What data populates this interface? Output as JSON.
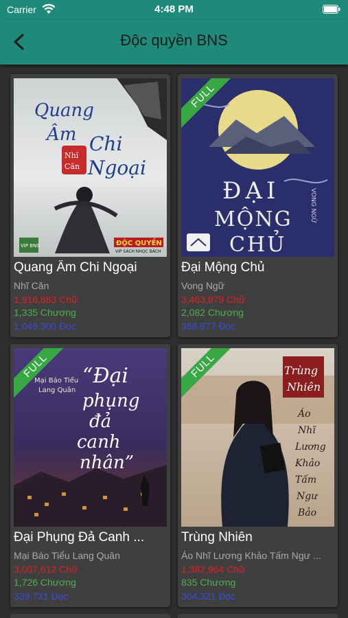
{
  "status_bar": {
    "carrier": "Carrier",
    "time": "4:48 PM",
    "wifi_icon": "wifi-icon",
    "battery_icon": "battery-icon"
  },
  "header": {
    "title": "Độc quyền BNS",
    "back_icon": "chevron-left-icon"
  },
  "colors": {
    "accent": "#1f8a7a",
    "background": "#2e2e2e",
    "card": "#3f3f3f",
    "characters": "#e02020",
    "chapters": "#4caf50",
    "reads": "#3b4bd9",
    "full_badge": "#37a843"
  },
  "books": [
    {
      "title": "Quang Âm Chi Ngoại",
      "author": "Nhĩ Căn",
      "characters": "1,916,883 Chữ",
      "chapters": "1,335 Chương",
      "reads": "1,049,300 Đọc",
      "full": false,
      "cover": {
        "title_art": "Quang Âm Chi Ngoại",
        "author_art": "Nhĩ Căn",
        "ribbon": "ĐỘC QUYỀN",
        "sub": "VIP SÁCH NHỌC BÁCH",
        "logo": "VIP BNS"
      }
    },
    {
      "title": "Đại Mộng Chủ",
      "author": "Vong Ngữ",
      "characters": "3,463,879 Chữ",
      "chapters": "2,082 Chương",
      "reads": "358,877 Đọc",
      "full": true,
      "badge": "FULL",
      "cover": {
        "title_art": "ĐẠI MỘNG CHỦ",
        "author_art": "VONG NGỮ"
      }
    },
    {
      "title": "Đại Phụng Đả Canh ...",
      "author": "Mại Báo Tiểu Lang Quân",
      "characters": "3,007,612 Chữ",
      "chapters": "1,726 Chương",
      "reads": "339,731 Đọc",
      "full": true,
      "badge": "FULL",
      "cover": {
        "title_art": "“Đại phụng đả canh nhân”",
        "author_art": "Mại Báo Tiểu Lang Quân"
      }
    },
    {
      "title": "Trùng Nhiên",
      "author": "Áo Nhĩ Lương Khảo Tấm Ngư ...",
      "characters": "1,382,964 Chữ",
      "chapters": "835 Chương",
      "reads": "304,321 Đọc",
      "full": true,
      "badge": "FULL",
      "cover": {
        "title_art": "Trùng Nhiên",
        "author_art": "Áo Nhĩ Lương Khảo Tấm Ngư Bảo"
      }
    }
  ]
}
